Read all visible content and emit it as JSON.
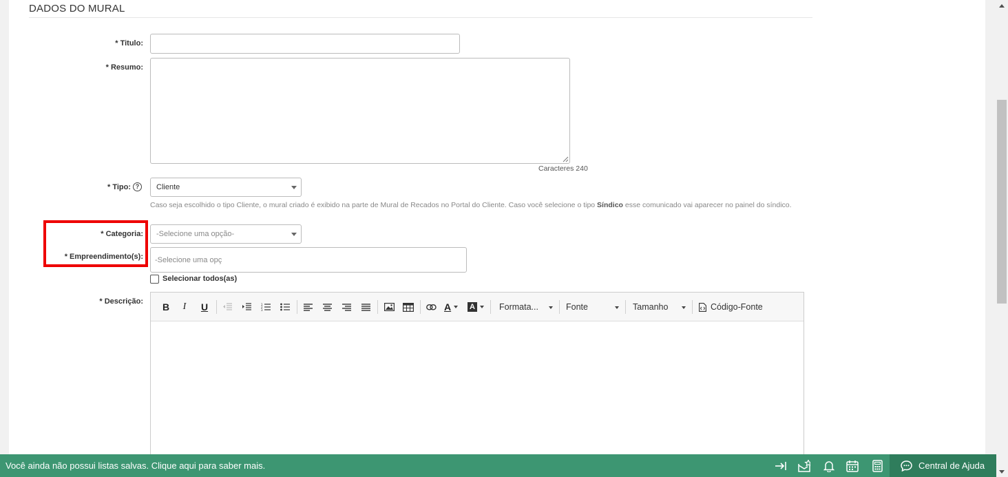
{
  "section": {
    "title": "DADOS DO MURAL"
  },
  "fields": {
    "titulo": {
      "label": "Titulo:",
      "value": ""
    },
    "resumo": {
      "label": "Resumo:",
      "value": "",
      "counter": "Caracteres 240"
    },
    "tipo": {
      "label": "Tipo:",
      "value": "Cliente",
      "hint_part1": "Caso seja escolhido o tipo Cliente, o mural criado é exibido na parte de Mural de Recados no Portal do Cliente. Caso você selecione o tipo ",
      "hint_bold": "Síndico",
      "hint_part2": " esse comunicado vai aparecer no painel do síndico."
    },
    "categoria": {
      "label": "Categoria:",
      "placeholder": "-Selecione uma opção-"
    },
    "empreendimento": {
      "label": "Empreendimento(s):",
      "placeholder": "-Selecione uma opç"
    },
    "select_all": {
      "label": "Selecionar todos(as)",
      "checked": false
    },
    "descricao": {
      "label": "Descrição:"
    }
  },
  "required_mark": "*",
  "editor": {
    "bold": "B",
    "italic": "I",
    "underline": "U",
    "format_label": "Formata...",
    "font_label": "Fonte",
    "size_label": "Tamanho",
    "source_label": "Código-Fonte",
    "font_color_glyph": "A",
    "bg_color_glyph": "A"
  },
  "bottombar": {
    "message": "Você ainda não possui listas salvas. Clique aqui para saber mais.",
    "help_center": "Central de Ajuda",
    "color": "#3d9672"
  },
  "highlight_color": "#e00000"
}
